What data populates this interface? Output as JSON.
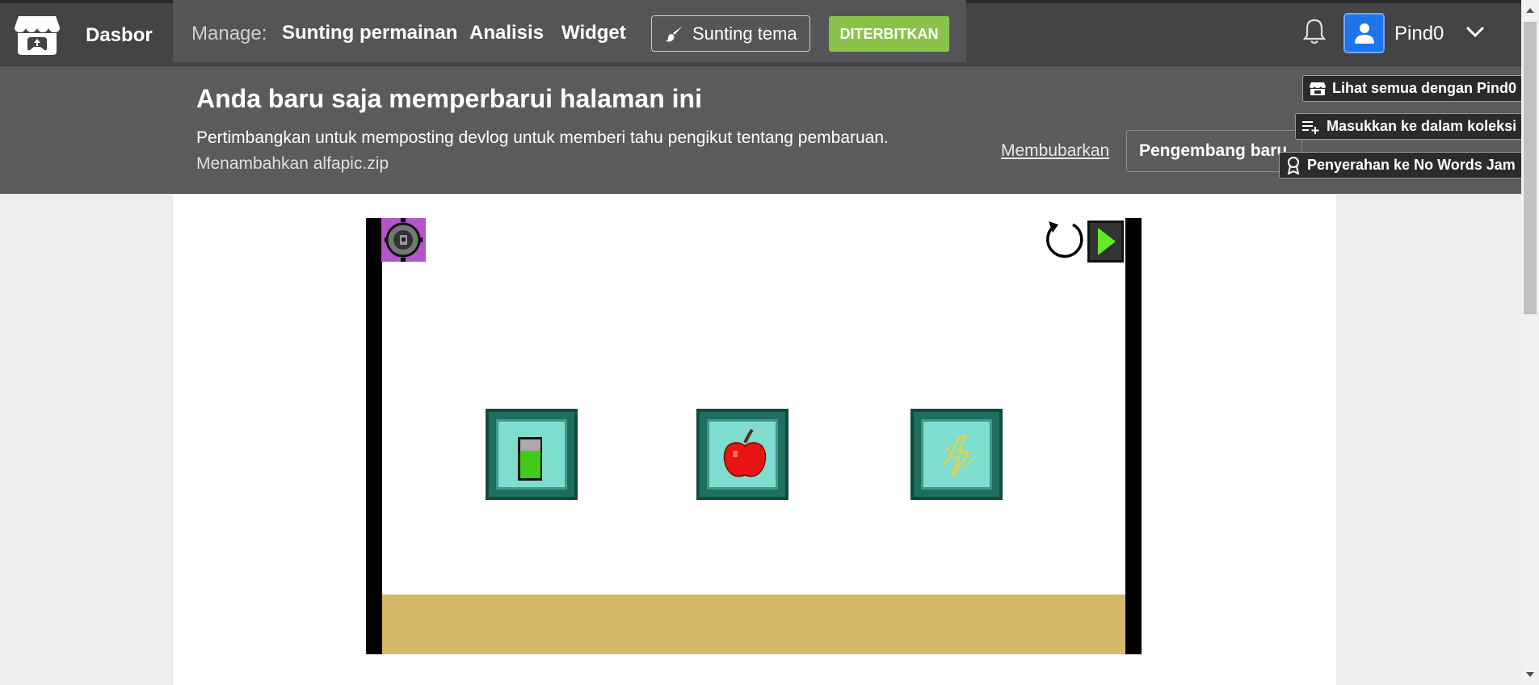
{
  "nav": {
    "dashboard": "Dasbor",
    "manage_label": "Manage:",
    "edit_game": "Sunting permainan",
    "analytics": "Analisis",
    "widget": "Widget",
    "edit_theme": "Sunting tema",
    "published": "DITERBITKAN",
    "username": "Pind0"
  },
  "notice": {
    "title": "Anda baru saja memperbarui halaman ini",
    "text": "Pertimbangkan untuk memposting devlog untuk memberi tahu pengikut tentang pembaruan.",
    "file": "Menambahkan alfapic.zip",
    "dismiss": "Membubarkan",
    "new_devlog": "Pengembang baru"
  },
  "floating": {
    "view_all": "Lihat semua dengan Pind0",
    "add_collection": "Masukkan ke dalam koleksi",
    "submission": "Penyerahan ke No Words Jam"
  },
  "colors": {
    "topbar": "#444446",
    "notice": "#5b5b5d",
    "published": "#8bc34a",
    "avatar": "#1e74e8",
    "floor": "#d5b96a",
    "tile": "#1f6e5e",
    "tile_inner": "#7fddd0"
  },
  "game": {
    "tiles": [
      {
        "icon": "battery-icon"
      },
      {
        "icon": "apple-icon"
      },
      {
        "icon": "lightning-icon"
      }
    ]
  }
}
